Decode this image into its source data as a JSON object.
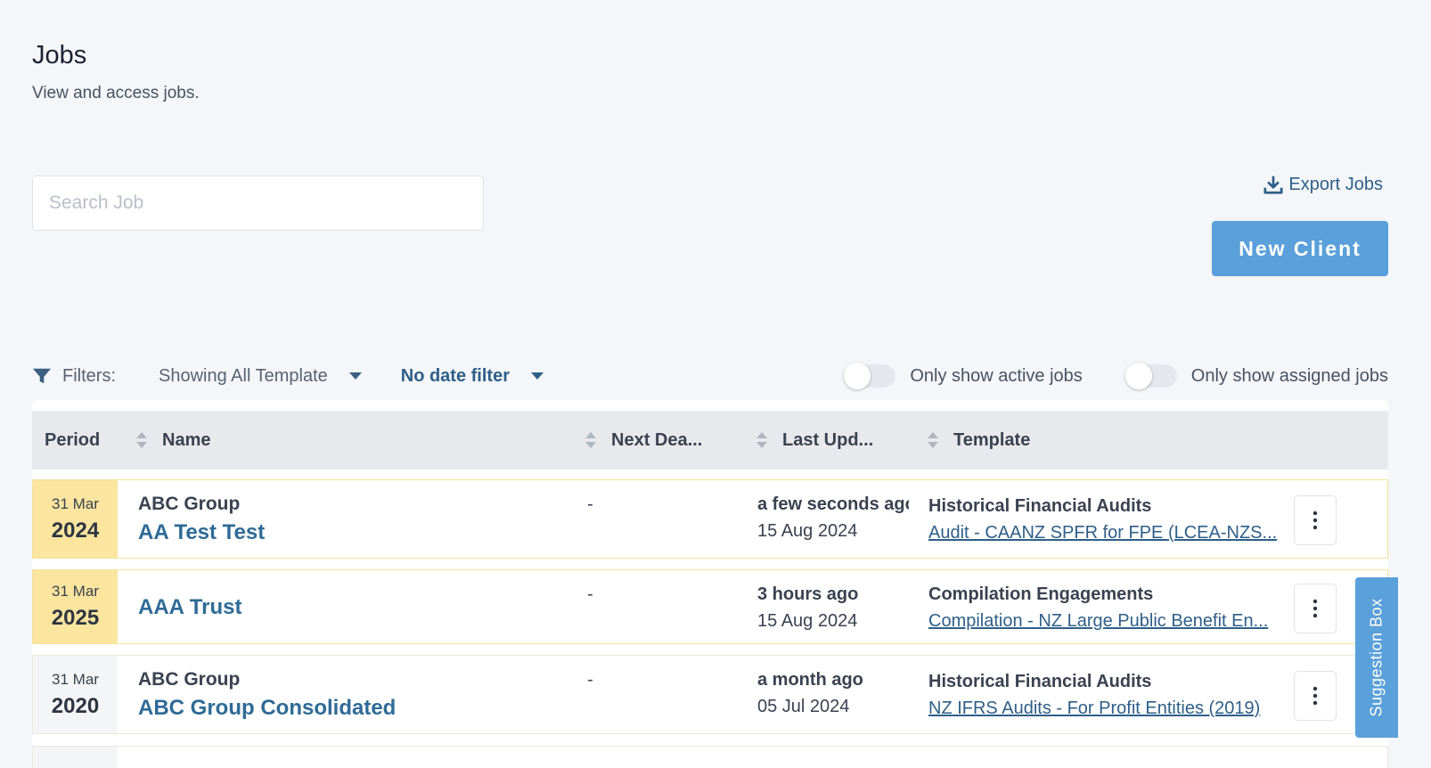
{
  "page": {
    "title": "Jobs",
    "subtitle": "View and access jobs."
  },
  "search": {
    "placeholder": "Search Job",
    "value": ""
  },
  "actions": {
    "export_label": "Export Jobs",
    "new_client_label": "New Client"
  },
  "filters": {
    "label": "Filters:",
    "template_filter": "Showing All Template",
    "date_filter": "No date filter",
    "active_toggle_label": "Only show active jobs",
    "active_toggle_on": false,
    "assigned_toggle_label": "Only show assigned jobs",
    "assigned_toggle_on": false
  },
  "table": {
    "columns": {
      "period": "Period",
      "name": "Name",
      "next_deadline": "Next Dea...",
      "last_updated": "Last Upd...",
      "template": "Template"
    },
    "rows": [
      {
        "period_day": "31 Mar",
        "period_year": "2024",
        "client": "ABC Group",
        "name": "AA Test Test",
        "deadline": "-",
        "updated_relative": "a few seconds ago",
        "updated_date": "15 Aug 2024",
        "template_category": "Historical Financial Audits",
        "template_name": "Audit - CAANZ SPFR for FPE (LCEA-NZS...",
        "highlight": true
      },
      {
        "period_day": "31 Mar",
        "period_year": "2025",
        "client": "",
        "name": "AAA Trust",
        "deadline": "-",
        "updated_relative": "3 hours ago",
        "updated_date": "15 Aug 2024",
        "template_category": "Compilation Engagements",
        "template_name": "Compilation - NZ Large Public Benefit En...",
        "highlight": true
      },
      {
        "period_day": "31 Mar",
        "period_year": "2020",
        "client": "ABC Group",
        "name": "ABC Group Consolidated",
        "deadline": "-",
        "updated_relative": "a month ago",
        "updated_date": "05 Jul 2024",
        "template_category": "Historical Financial Audits",
        "template_name": "NZ IFRS Audits - For Profit Entities (2019)",
        "highlight": false
      }
    ]
  },
  "suggestion_box": {
    "label": "Suggestion Box"
  },
  "colors": {
    "accent": "#5aa0da",
    "link": "#2e6b96",
    "highlight_period": "#fbe59f",
    "page_bg": "#f4f6f9"
  },
  "icons": {
    "export": "download-icon",
    "filter": "filter-icon",
    "sort": "sort-icon",
    "row_menu": "kebab-icon"
  }
}
